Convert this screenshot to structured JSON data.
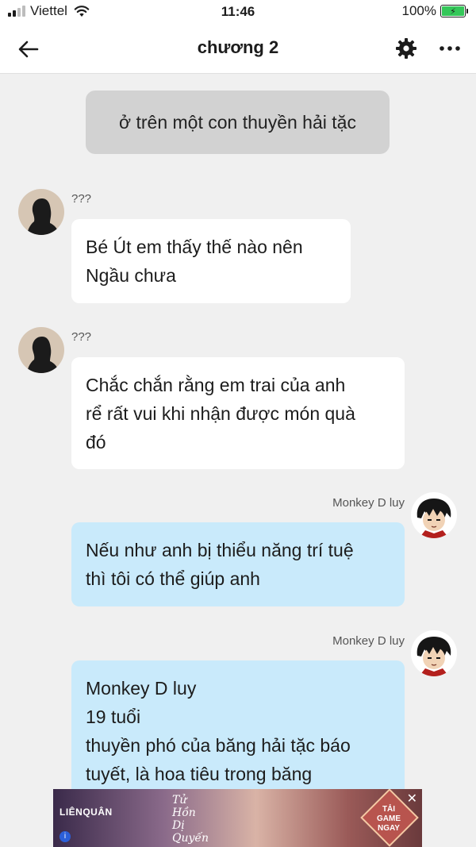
{
  "status_bar": {
    "carrier": "Viettel",
    "time": "11:46",
    "battery": "100%",
    "battery_level": 1.0
  },
  "header": {
    "title": "chương 2",
    "back_icon": "arrow-left-icon",
    "settings_icon": "gear-icon",
    "more_icon": "more-horizontal-icon"
  },
  "messages": [
    {
      "type": "narration",
      "text": "ở trên một con thuyền hải tặc"
    },
    {
      "type": "left",
      "name": "???",
      "lines": [
        "Bé Út em thấy thế nào nên",
        "Ngầu chưa"
      ]
    },
    {
      "type": "left",
      "name": "???",
      "lines": [
        "Chắc chắn rằng em trai của anh",
        "rể rất vui khi nhận được món quà",
        "đó"
      ]
    },
    {
      "type": "right",
      "name": "Monkey D luy",
      "lines": [
        "Nếu như anh bị thiểu năng trí tuệ",
        "thì tôi có thể giúp anh"
      ]
    },
    {
      "type": "right",
      "name": "Monkey D luy",
      "lines": [
        "Monkey D luy",
        "19 tuổi",
        "thuyền phó của băng hải tặc báo",
        "tuyết,  là hoa tiêu trong băng"
      ]
    }
  ],
  "ad": {
    "logo_text": "LIÊNQUÂN",
    "script_lines": [
      "Tử",
      "Hồn",
      "Dị",
      "Quyến"
    ],
    "cta_lines": [
      "TẢI",
      "GAME",
      "NGAY"
    ],
    "close_icon": "close-icon",
    "info_icon": "info-icon"
  }
}
